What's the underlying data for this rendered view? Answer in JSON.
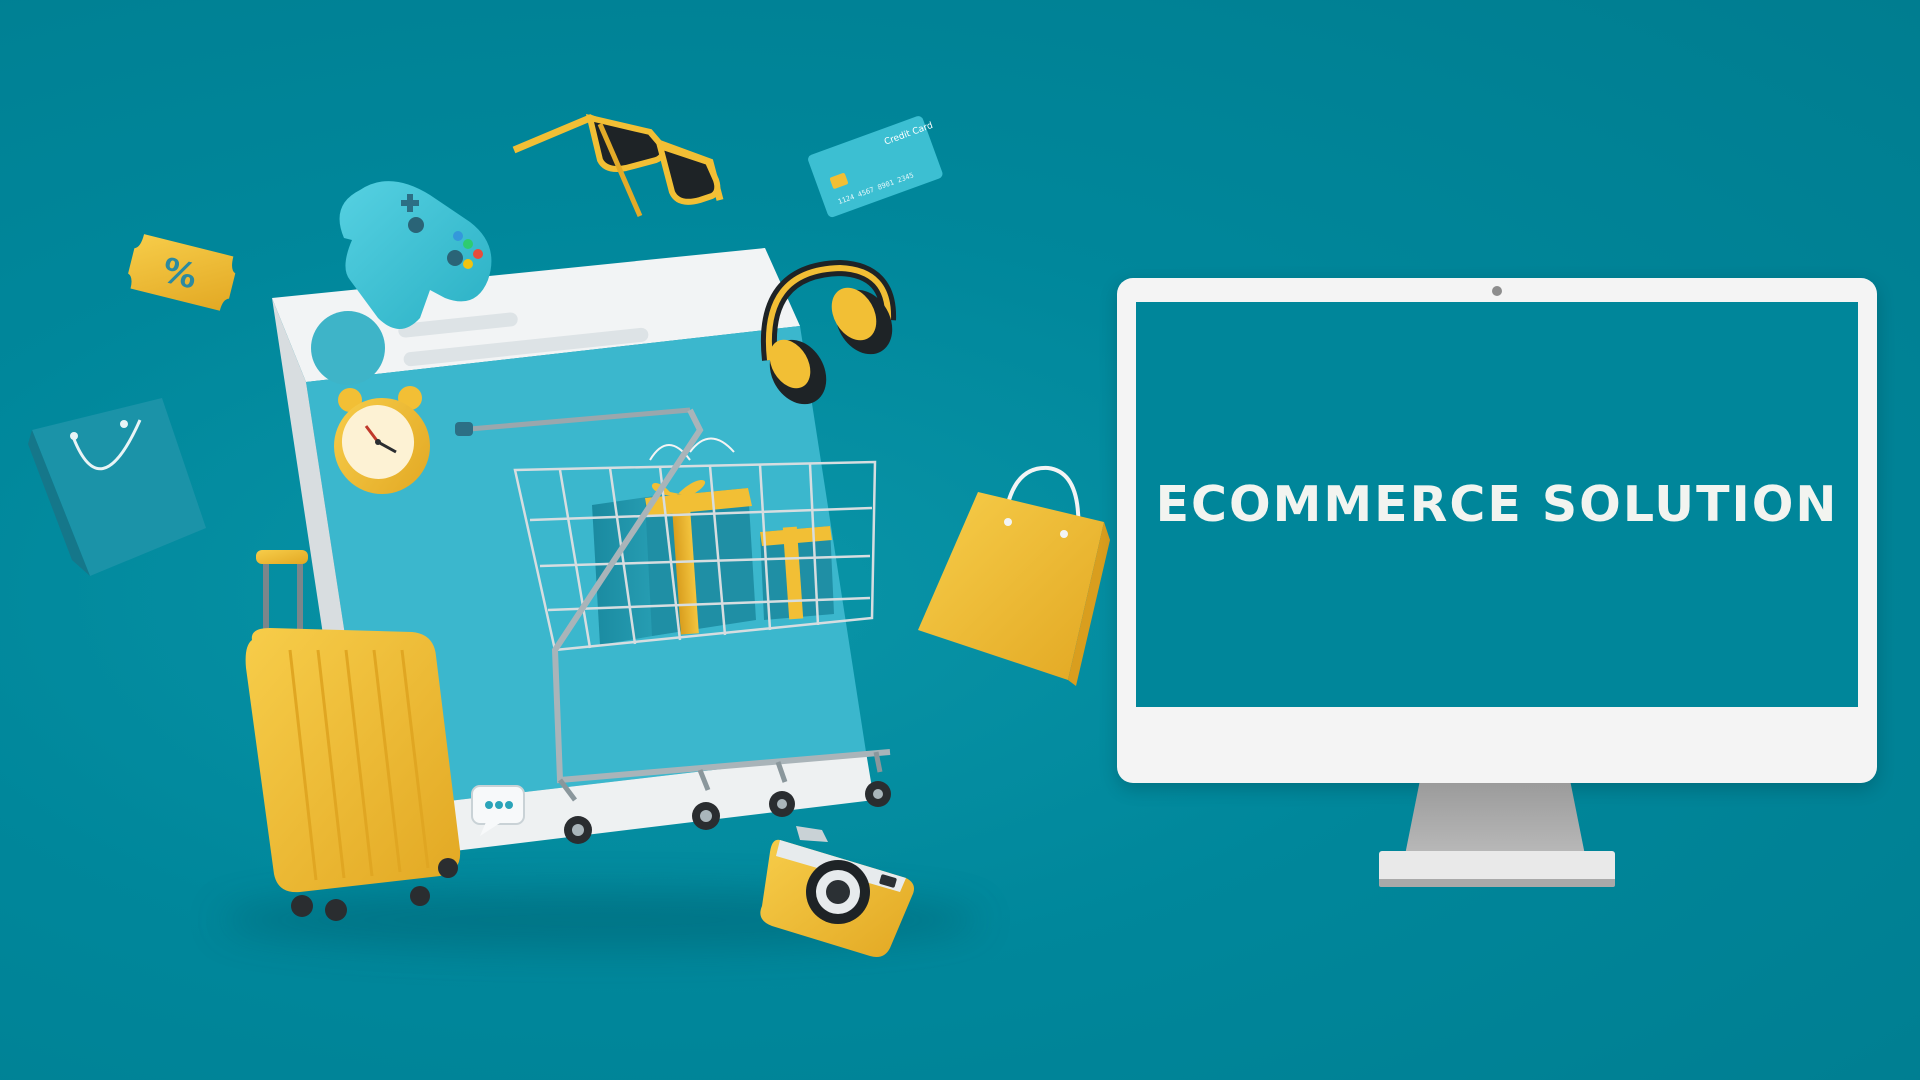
{
  "headline": "ECOMMERCE SOLUTION",
  "credit_card_label": "Credit Card",
  "credit_card_number": "1124 4567 8901 2345",
  "discount_tag_symbol": "%",
  "icons": [
    "shopping-cart-icon",
    "gift-box-icon",
    "suitcase-icon",
    "shopping-bag-icon",
    "camera-icon",
    "headphones-icon",
    "sunglasses-icon",
    "game-controller-icon",
    "alarm-clock-icon",
    "credit-card-icon",
    "discount-coupon-icon",
    "chat-bubble-icon",
    "desktop-monitor-icon"
  ],
  "colors": {
    "background": "#00869a",
    "accent_yellow": "#f2bf35",
    "accent_cyan": "#3cbfd2",
    "screen_text": "#f2f4f0",
    "monitor_frame": "#f4f4f4"
  }
}
